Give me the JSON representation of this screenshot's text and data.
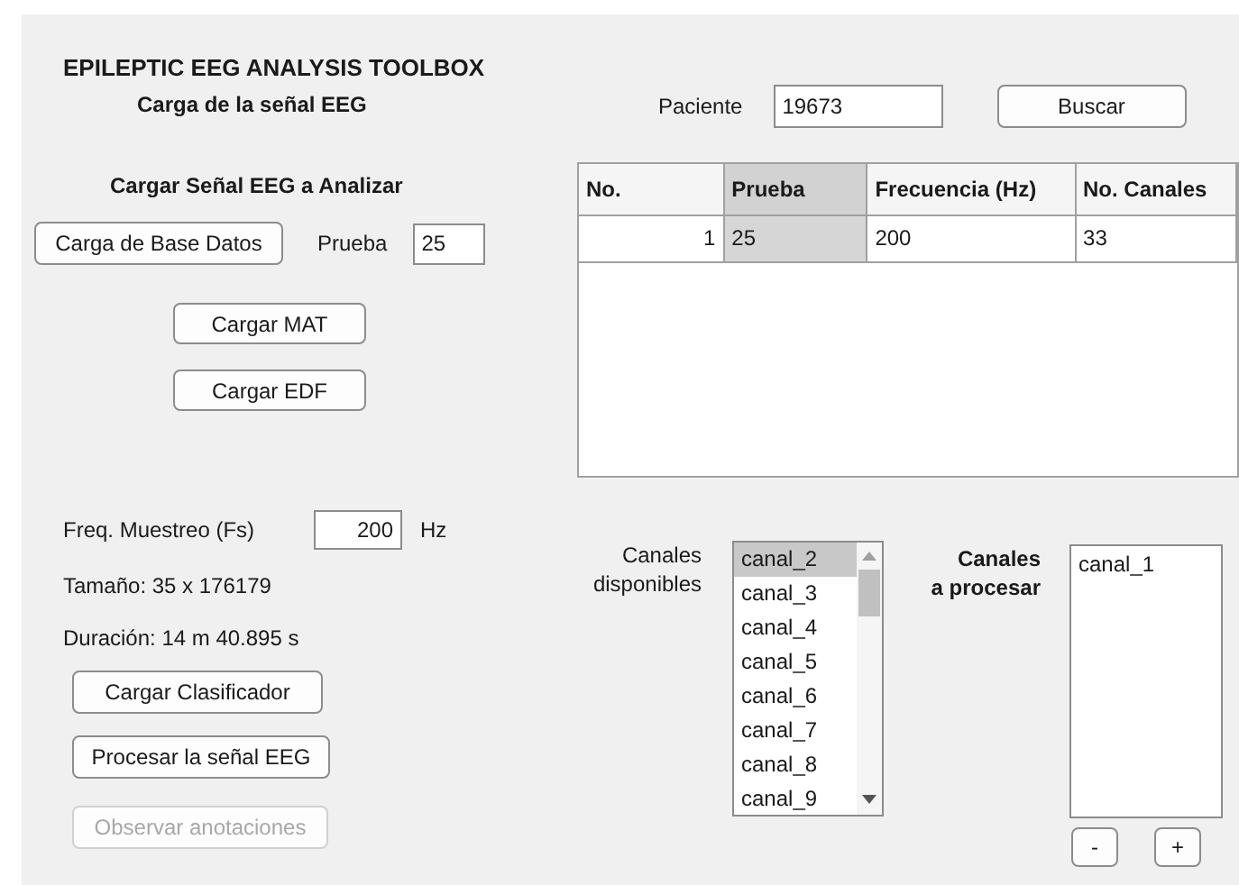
{
  "title": "EPILEPTIC EEG ANALYSIS TOOLBOX",
  "subtitle": "Carga de la señal EEG",
  "load_section": {
    "heading": "Cargar Señal EEG a Analizar",
    "database_button": {
      "label": "Carga de Base Datos",
      "disabled": false
    },
    "prueba": {
      "label": "Prueba",
      "value": "25"
    },
    "buttons": [
      {
        "label": "Cargar MAT",
        "disabled": false
      },
      {
        "label": "Cargar EDF",
        "disabled": false
      }
    ]
  },
  "patient": {
    "label": "Paciente",
    "value": "19673",
    "search_button": "Buscar"
  },
  "table": {
    "columns": [
      {
        "label": "No.",
        "selected": false
      },
      {
        "label": "Prueba",
        "selected": true
      },
      {
        "label": "Frecuencia (Hz)",
        "selected": false
      },
      {
        "label": "No. Canales",
        "selected": false
      }
    ],
    "rows": [
      [
        "1",
        "25",
        "200",
        "33"
      ]
    ]
  },
  "signal_info": {
    "fs_label": "Freq. Muestreo (Fs)",
    "fs_value": "200",
    "fs_unit": "Hz",
    "size": "Tamaño: 35 x 176179",
    "duration": "Duración: 14 m 40.895 s"
  },
  "actions": [
    {
      "label": "Cargar Clasificador",
      "disabled": false
    },
    {
      "label": "Procesar la señal EEG",
      "disabled": false
    },
    {
      "label": "Observar anotaciones",
      "disabled": true
    }
  ],
  "available_channels": {
    "label": "Canales disponibles",
    "items": [
      {
        "label": "canal_2",
        "selected": true
      },
      {
        "label": "canal_3",
        "selected": false
      },
      {
        "label": "canal_4",
        "selected": false
      },
      {
        "label": "canal_5",
        "selected": false
      },
      {
        "label": "canal_6",
        "selected": false
      },
      {
        "label": "canal_7",
        "selected": false
      },
      {
        "label": "canal_8",
        "selected": false
      },
      {
        "label": "canal_9",
        "selected": false
      }
    ]
  },
  "channels_to_process": {
    "label_lines": [
      "Canales",
      "a procesar"
    ],
    "items": [
      {
        "label": "canal_1",
        "selected": false
      }
    ],
    "remove_button": "-",
    "add_button": "+"
  }
}
